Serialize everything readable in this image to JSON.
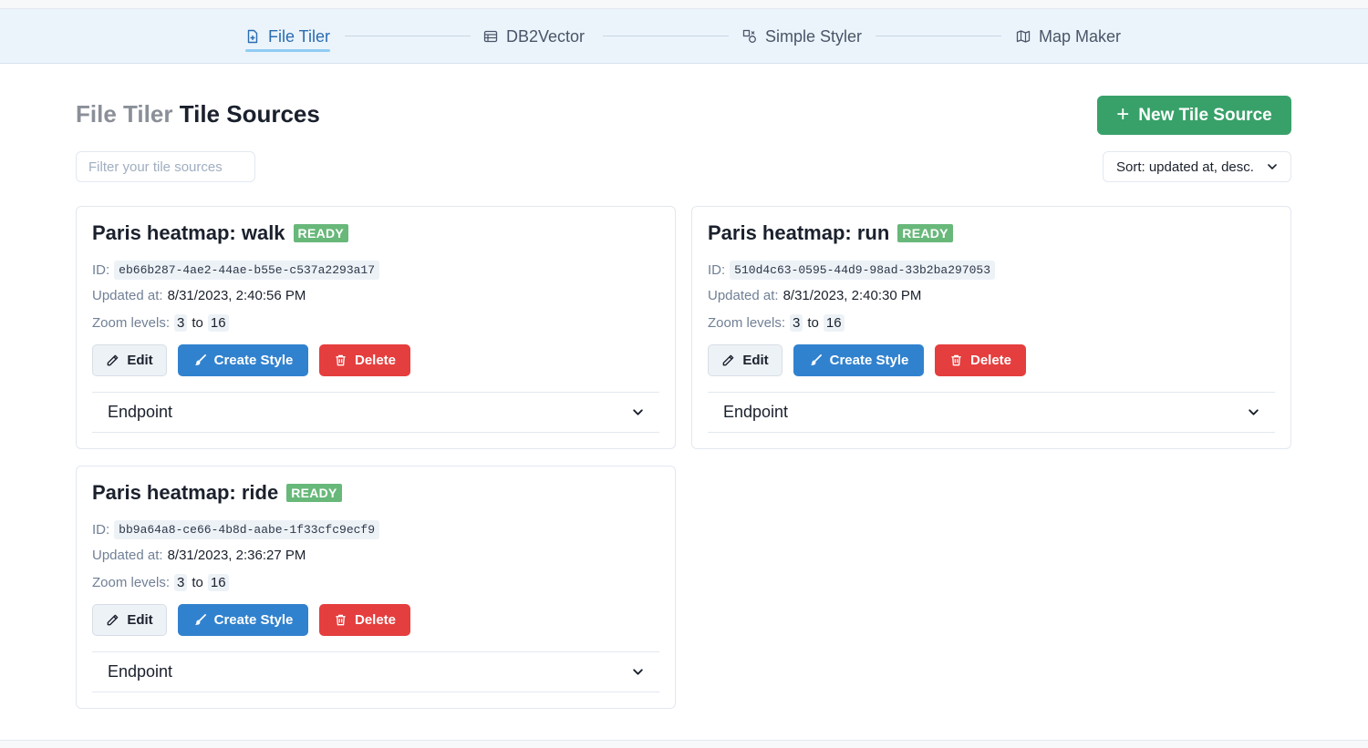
{
  "nav": {
    "items": [
      {
        "label": "File Tiler",
        "icon": "file-plus-icon",
        "active": true
      },
      {
        "label": "DB2Vector",
        "icon": "table-icon",
        "active": false
      },
      {
        "label": "Simple Styler",
        "icon": "shapes-icon",
        "active": false
      },
      {
        "label": "Map Maker",
        "icon": "map-icon",
        "active": false
      }
    ]
  },
  "header": {
    "title_prefix": "File Tiler",
    "title_main": "Tile Sources",
    "new_button_label": "New Tile Source"
  },
  "filter": {
    "placeholder": "Filter your tile sources",
    "value": ""
  },
  "sort": {
    "label": "Sort: updated at, desc."
  },
  "labels": {
    "id": "ID:",
    "updated": "Updated at:",
    "zoom": "Zoom levels:",
    "zoom_to": "to",
    "edit": "Edit",
    "create_style": "Create Style",
    "delete": "Delete",
    "endpoint": "Endpoint"
  },
  "cards": [
    {
      "title": "Paris heatmap: walk",
      "status": "READY",
      "id": "eb66b287-4ae2-44ae-b55e-c537a2293a17",
      "updated": "8/31/2023, 2:40:56 PM",
      "zoom_min": "3",
      "zoom_max": "16"
    },
    {
      "title": "Paris heatmap: run",
      "status": "READY",
      "id": "510d4c63-0595-44d9-98ad-33b2ba297053",
      "updated": "8/31/2023, 2:40:30 PM",
      "zoom_min": "3",
      "zoom_max": "16"
    },
    {
      "title": "Paris heatmap: ride",
      "status": "READY",
      "id": "bb9a64a8-ce66-4b8d-aabe-1f33cfc9ecf9",
      "updated": "8/31/2023, 2:36:27 PM",
      "zoom_min": "3",
      "zoom_max": "16"
    }
  ],
  "colors": {
    "accent": "#2b6cb0",
    "primary_green": "#38a169",
    "primary_blue": "#3182ce",
    "danger_red": "#e53e3e",
    "ready_badge": "#68b87a",
    "nav_bg": "#ebf4fb"
  }
}
